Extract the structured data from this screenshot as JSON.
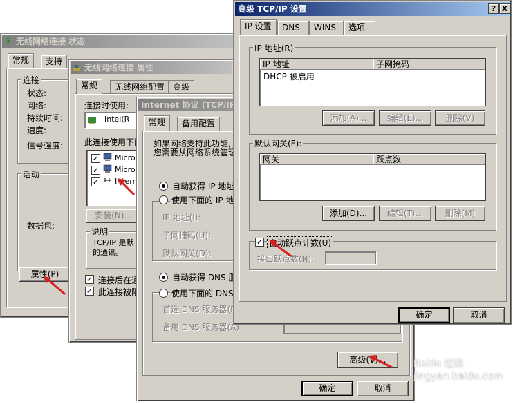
{
  "status_window": {
    "title": "无线网络连接 状态",
    "tabs": [
      "常规",
      "支持"
    ],
    "connection_group": "连接",
    "labels": [
      "状态:",
      "网络:",
      "持续时间:",
      "速度:",
      "信号强度:"
    ],
    "activity_group": "活动",
    "packets_label": "数据包:",
    "properties_button": "属性(P)"
  },
  "props_window": {
    "title": "无线网络连接 属性",
    "tabs": [
      "常规",
      "无线网络配置",
      "高级"
    ],
    "connect_using": "连接时使用:",
    "adapter_name": "Intel(R",
    "items_label": "此连接使用下面",
    "items": [
      "Micro",
      "Micro",
      "Interne"
    ],
    "install_button": "安装(N)...",
    "desc_group": "说明",
    "desc_line1": "TCP/IP 是默",
    "desc_line2": "的通讯。",
    "show_icon": "连接后在通",
    "notify": "此连接被限"
  },
  "tcpip_window": {
    "title": "Internet 协议 (TCP/IP) 属",
    "tabs": [
      "常规",
      "备用配置"
    ],
    "intro1": "如果网络支持此功能,",
    "intro2": "您需要从网络系统管理",
    "auto_ip": "自动获得 IP 地址",
    "manual_ip": "使用下面的 IP 地",
    "ip_label": "IP 地址(I):",
    "mask_label": "子网掩码(U):",
    "gateway_label": "默认网关(D):",
    "auto_dns": "自动获得 DNS 服",
    "manual_dns": "使用下面的 DNS",
    "pref_dns": "首选 DNS 服务器(P)",
    "alt_dns": "备用 DNS 服务器(A)",
    "advanced_button": "高级(V)...",
    "ok_button": "确定",
    "cancel_button": "取消"
  },
  "adv_window": {
    "title": "高级 TCP/IP 设置",
    "help_glyph": "?",
    "close_glyph": "X",
    "tabs": [
      "IP 设置",
      "DNS",
      "WINS",
      "选项"
    ],
    "ip_group": "IP 地址(R)",
    "ip_col1": "IP 地址",
    "ip_col2": "子网掩码",
    "ip_row": "DHCP 被启用",
    "gw_group": "默认网关(F):",
    "gw_col1": "网关",
    "gw_col2": "跃点数",
    "add_disabled": "添加(A)...",
    "edit_disabled": "编辑(E)...",
    "remove_disabled": "删除(V)",
    "add_gw": "添加(D)...",
    "edit_gw": "编辑(T)...",
    "remove_gw": "删除(M)",
    "auto_metric": "自动跃点计数(U)",
    "iface_metric": "接口跃点数(N):",
    "ok_button": "确定",
    "cancel_button": "取消"
  },
  "watermark": "Baidu 经验 jingyan.baidu.com",
  "colors": {
    "arrow": "#d42020",
    "title_active": "#0a246a",
    "face": "#d4d0c8"
  }
}
